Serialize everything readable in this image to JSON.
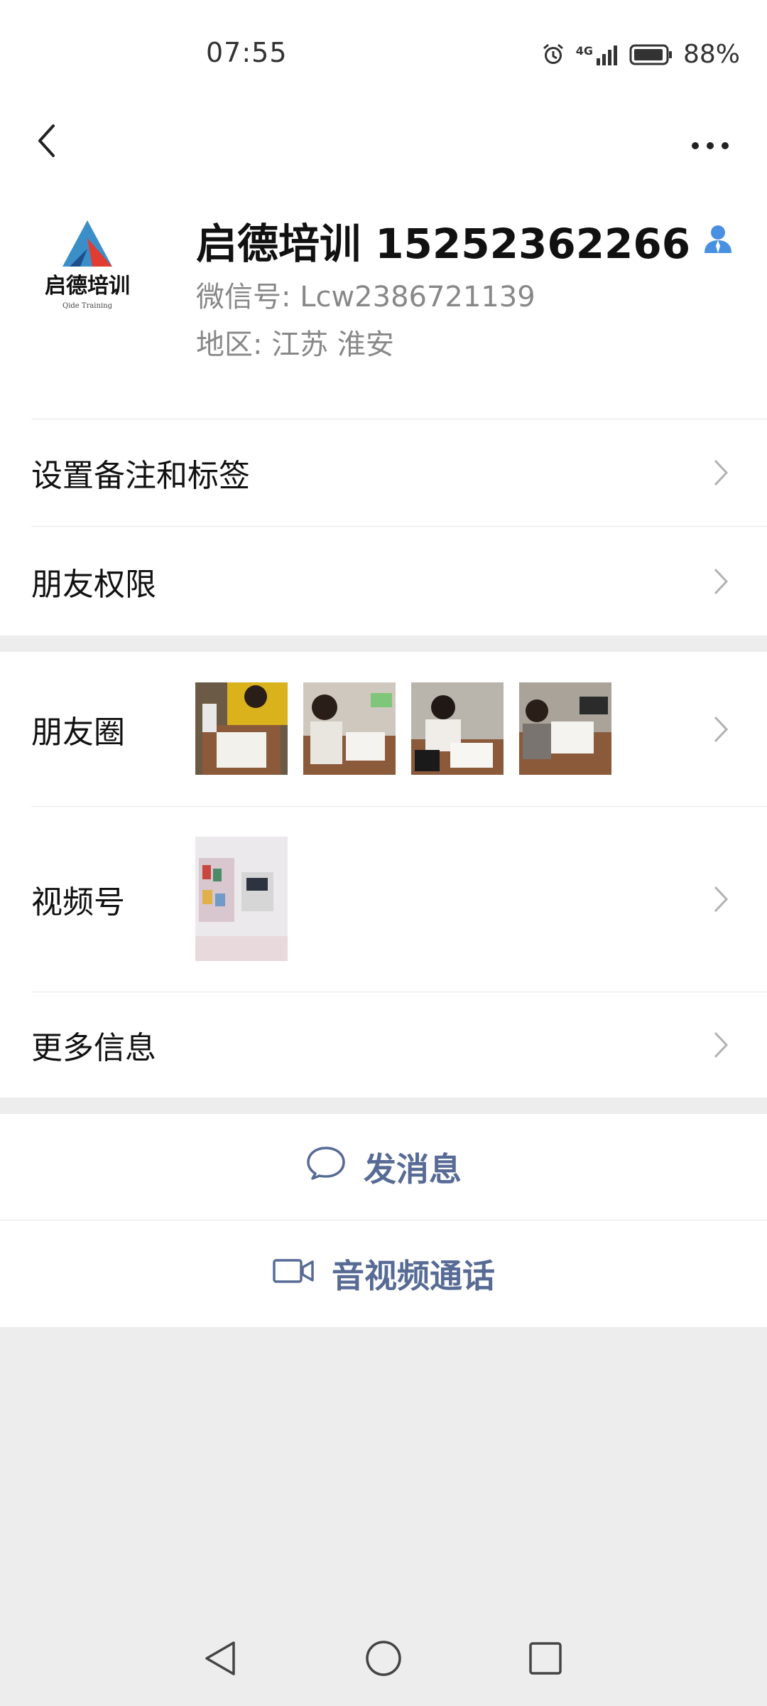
{
  "status_bar": {
    "time": "07:55",
    "network": "4G",
    "battery": "88%"
  },
  "contact": {
    "name": "启德培训 15252362266",
    "avatar_brand": "启德培训",
    "avatar_subbrand": "Qide Training",
    "wechat_id": "微信号: Lcw2386721139",
    "region": "地区: 江苏  淮安"
  },
  "menu": {
    "remark_label": "设置备注和标签",
    "permission_label": "朋友权限",
    "moments_label": "朋友圈",
    "channels_label": "视频号",
    "more_info_label": "更多信息"
  },
  "actions": {
    "message_label": "发消息",
    "call_label": "音视频通话"
  },
  "colors": {
    "link": "#576b95",
    "background": "#ededed",
    "verified": "#4a90e2"
  }
}
